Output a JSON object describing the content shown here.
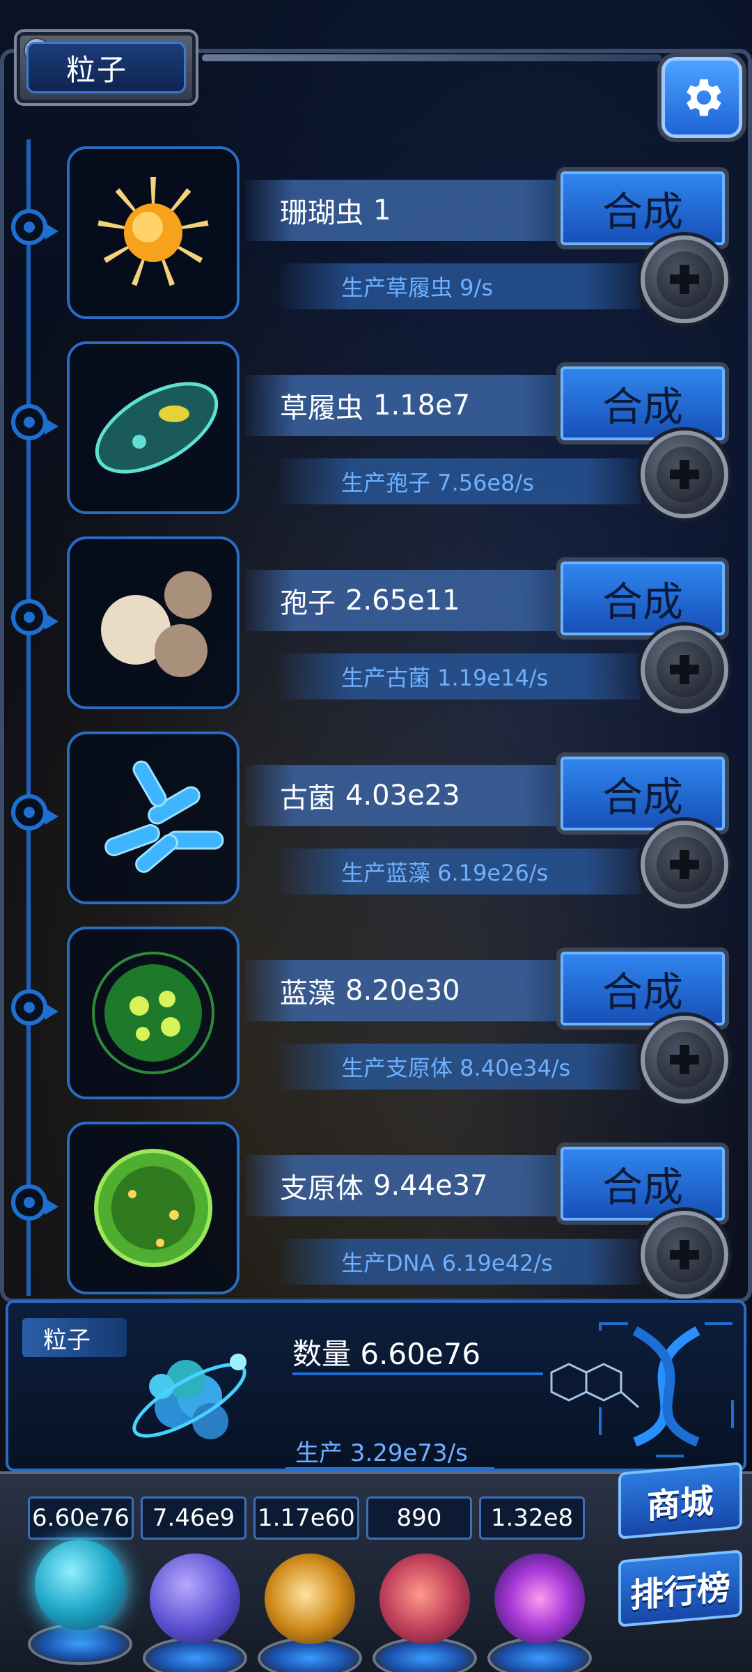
{
  "header": {
    "tab_title": "粒子",
    "settings_icon": "gear-icon"
  },
  "items": [
    {
      "name": "珊瑚虫",
      "count": "1",
      "produces": "生产草履虫 9/s",
      "craft_label": "合成",
      "icon": "sun-organism-icon"
    },
    {
      "name": "草履虫",
      "count": "1.18e7",
      "produces": "生产孢子 7.56e8/s",
      "craft_label": "合成",
      "icon": "paramecium-icon"
    },
    {
      "name": "孢子",
      "count": "2.65e11",
      "produces": "生产古菌 1.19e14/s",
      "craft_label": "合成",
      "icon": "spore-icon"
    },
    {
      "name": "古菌",
      "count": "4.03e23",
      "produces": "生产蓝藻 6.19e26/s",
      "craft_label": "合成",
      "icon": "archaea-icon"
    },
    {
      "name": "蓝藻",
      "count": "8.20e30",
      "produces": "生产支原体 8.40e34/s",
      "craft_label": "合成",
      "icon": "cyanobacteria-icon"
    },
    {
      "name": "支原体",
      "count": "9.44e37",
      "produces": "生产DNA 6.19e42/s",
      "craft_label": "合成",
      "icon": "mycoplasma-icon"
    }
  ],
  "panel": {
    "tag": "粒子",
    "quantity": "数量 6.60e76",
    "production": "生产 3.29e73/s"
  },
  "footer": {
    "stats": [
      "6.60e76",
      "7.46e9",
      "1.17e60",
      "890",
      "1.32e8"
    ],
    "shop_label": "商城",
    "rank_label": "排行榜"
  },
  "colors": {
    "accent": "#1f6fd1",
    "button": "#2f86ee",
    "text_blue": "#6fb0ff"
  }
}
